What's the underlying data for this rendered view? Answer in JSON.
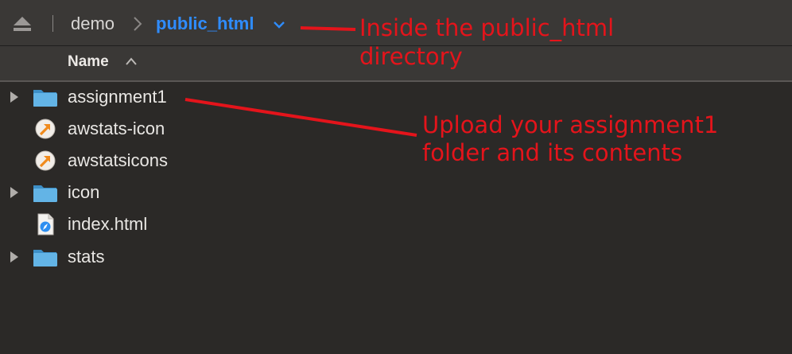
{
  "path_bar": {
    "crumbs": [
      "demo",
      "public_html"
    ]
  },
  "column_header": {
    "label": "Name"
  },
  "files": [
    {
      "name": "assignment1",
      "kind": "folder",
      "expandable": true
    },
    {
      "name": "awstats-icon",
      "kind": "alias",
      "expandable": false
    },
    {
      "name": "awstatsicons",
      "kind": "alias",
      "expandable": false
    },
    {
      "name": "icon",
      "kind": "folder",
      "expandable": true
    },
    {
      "name": "index.html",
      "kind": "html",
      "expandable": false
    },
    {
      "name": "stats",
      "kind": "folder",
      "expandable": true
    }
  ],
  "annotations": {
    "public_html": [
      "Inside the public_html",
      "directory"
    ],
    "upload": [
      "Upload your assignment1",
      "folder and its contents"
    ]
  },
  "colors": {
    "background": "#2b2927",
    "toolbar": "#3a3836",
    "accent_blue": "#2f8cff",
    "annotation_red": "#e4141b",
    "folder_blue": "#5aaee0"
  }
}
